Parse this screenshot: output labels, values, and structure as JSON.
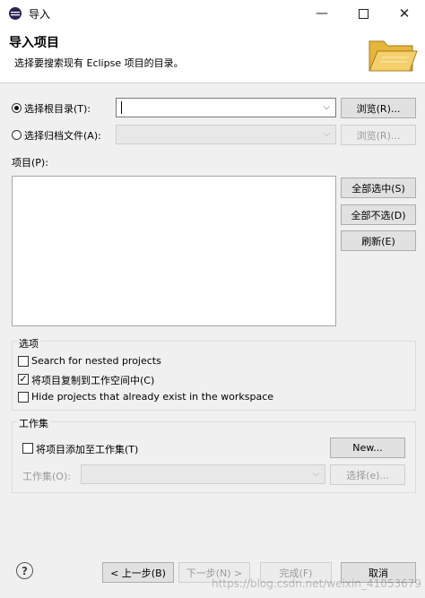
{
  "window": {
    "title": "导入"
  },
  "header": {
    "title": "导入项目",
    "description": "选择要搜索现有 Eclipse 项目的目录。"
  },
  "source": {
    "root_dir_label": "选择根目录(T):",
    "root_dir_value": "",
    "archive_label": "选择归档文件(A):",
    "browse_label": "浏览(R)...",
    "browse2_label": "浏览(R)..."
  },
  "projects": {
    "label": "项目(P):",
    "select_all": "全部选中(S)",
    "deselect_all": "全部不选(D)",
    "refresh": "刷新(E)"
  },
  "options": {
    "title": "选项",
    "items": [
      {
        "label": "Search for nested projects",
        "checked": false
      },
      {
        "label": "将项目复制到工作空间中(C)",
        "checked": true
      },
      {
        "label": "Hide projects that already exist in the workspace",
        "checked": false
      }
    ]
  },
  "working_sets": {
    "title": "工作集",
    "add_label": "将项目添加至工作集(T)",
    "new_button": "New...",
    "set_label": "工作集(O):",
    "select_button": "选择(e)..."
  },
  "footer": {
    "back": "< 上一步(B)",
    "next": "下一步(N) >",
    "finish": "完成(F)",
    "cancel": "取消"
  },
  "watermark": "https://blog.csdn.net/weixin_41053679",
  "colors": {
    "accent": "#0078d7",
    "folder": "#f2c94c"
  }
}
